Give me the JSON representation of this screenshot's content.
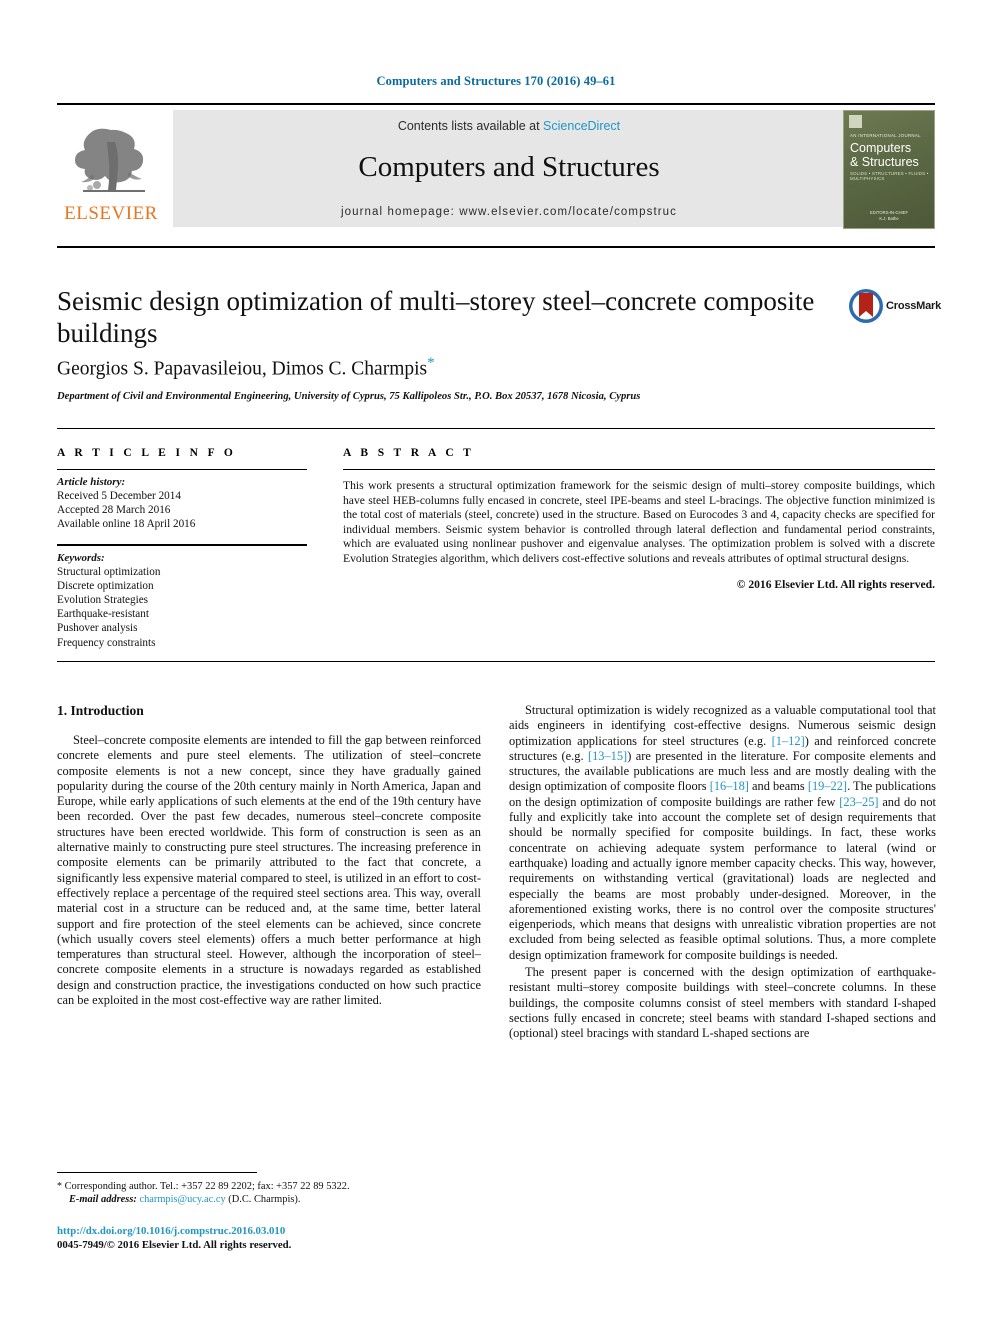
{
  "running_head": "Computers and Structures 170 (2016) 49–61",
  "masthead": {
    "contents_prefix": "Contents lists available at ",
    "sciencedirect": "ScienceDirect",
    "journal_title": "Computers and Structures",
    "homepage": "journal homepage: www.elsevier.com/locate/compstruc",
    "publisher_wordmark": "ELSEVIER",
    "cover": {
      "kicker": "AN INTERNATIONAL JOURNAL",
      "title_line1": "Computers",
      "title_line2": "& Structures",
      "subtitle": "SOLIDS • STRUCTURES • FLUIDS • MULTIPHYSICS",
      "footer_line1": "EDITORS-IN-CHIEF",
      "footer_line2": "K.J. Bathe"
    },
    "accent_link_color": "#2196c4",
    "panel_color": "#e6e6e6"
  },
  "article": {
    "title": "Seismic design optimization of multi–storey steel–concrete composite buildings",
    "authors": "Georgios S. Papavasileiou, Dimos C. Charmpis",
    "corresponding_marker": "*",
    "affiliation": "Department of Civil and Environmental Engineering, University of Cyprus, 75 Kallipoleos Str., P.O. Box 20537, 1678 Nicosia, Cyprus",
    "crossmark_label": "CrossMark"
  },
  "article_info": {
    "heading": "A R T I C L E   I N F O",
    "history_label": "Article history:",
    "history": [
      "Received 5 December 2014",
      "Accepted 28 March 2016",
      "Available online 18 April 2016"
    ],
    "keywords_label": "Keywords:",
    "keywords": [
      "Structural optimization",
      "Discrete optimization",
      "Evolution Strategies",
      "Earthquake-resistant",
      "Pushover analysis",
      "Frequency constraints"
    ]
  },
  "abstract": {
    "heading": "A B S T R A C T",
    "text": "This work presents a structural optimization framework for the seismic design of multi–storey composite buildings, which have steel HEB-columns fully encased in concrete, steel IPE-beams and steel L-bracings. The objective function minimized is the total cost of materials (steel, concrete) used in the structure. Based on Eurocodes 3 and 4, capacity checks are specified for individual members. Seismic system behavior is controlled through lateral deflection and fundamental period constraints, which are evaluated using nonlinear pushover and eigenvalue analyses. The optimization problem is solved with a discrete Evolution Strategies algorithm, which delivers cost-effective solutions and reveals attributes of optimal structural designs.",
    "copyright": "© 2016 Elsevier Ltd. All rights reserved."
  },
  "body": {
    "section_number_title": "1. Introduction",
    "left_paragraphs": [
      "Steel–concrete composite elements are intended to fill the gap between reinforced concrete elements and pure steel elements. The utilization of steel–concrete composite elements is not a new concept, since they have gradually gained popularity during the course of the 20th century mainly in North America, Japan and Europe, while early applications of such elements at the end of the 19th century have been recorded. Over the past few decades, numerous steel–concrete composite structures have been erected worldwide. This form of construction is seen as an alternative mainly to constructing pure steel structures. The increasing preference in composite elements can be primarily attributed to the fact that concrete, a significantly less expensive material compared to steel, is utilized in an effort to cost-effectively replace a percentage of the required steel sections area. This way, overall material cost in a structure can be reduced and, at the same time, better lateral support and fire protection of the steel elements can be achieved, since concrete (which usually covers steel elements) offers a much better performance at high temperatures than structural steel. However, although the incorporation of steel–concrete composite elements in a structure is nowadays regarded as established design and construction practice, the investigations conducted on how such practice can be exploited in the most cost-effective way are rather limited."
    ],
    "right_paragraph_1_parts": [
      "Structural optimization is widely recognized as a valuable computational tool that aids engineers in identifying cost-effective designs. Numerous seismic design optimization applications for steel structures (e.g. ",
      "[1–12]",
      ") and reinforced concrete structures (e.g. ",
      "[13–15]",
      ") are presented in the literature. For composite elements and structures, the available publications are much less and are mostly dealing with the design optimization of composite floors ",
      "[16–18]",
      " and beams ",
      "[19–22]",
      ". The publications on the design optimization of composite buildings are rather few ",
      "[23–25]",
      " and do not fully and explicitly take into account the complete set of design requirements that should be normally specified for composite buildings. In fact, these works concentrate on achieving adequate system performance to lateral (wind or earthquake) loading and actually ignore member capacity checks. This way, however, requirements on withstanding vertical (gravitational) loads are neglected and especially the beams are most probably under-designed. Moreover, in the aforementioned existing works, there is no control over the composite structures' eigenperiods, which means that designs with unrealistic vibration properties are not excluded from being selected as feasible optimal solutions. Thus, a more complete design optimization framework for composite buildings is needed."
    ],
    "right_paragraph_2": "The present paper is concerned with the design optimization of earthquake-resistant multi–storey composite buildings with steel–concrete columns. In these buildings, the composite columns consist of steel members with standard I-shaped sections fully encased in concrete; steel beams with standard I-shaped sections and (optional) steel bracings with standard L-shaped sections are"
  },
  "footnotes": {
    "corresponding_marker": "*",
    "corresponding_text": "Corresponding author. Tel.: +357 22 89 2202; fax: +357 22 89 5322.",
    "email_label": "E-mail address:",
    "email": "charmpis@ucy.ac.cy",
    "email_owner": "(D.C. Charmpis).",
    "doi_url": "http://dx.doi.org/10.1016/j.compstruc.2016.03.010",
    "issn_line": "0045-7949/© 2016 Elsevier Ltd. All rights reserved."
  }
}
